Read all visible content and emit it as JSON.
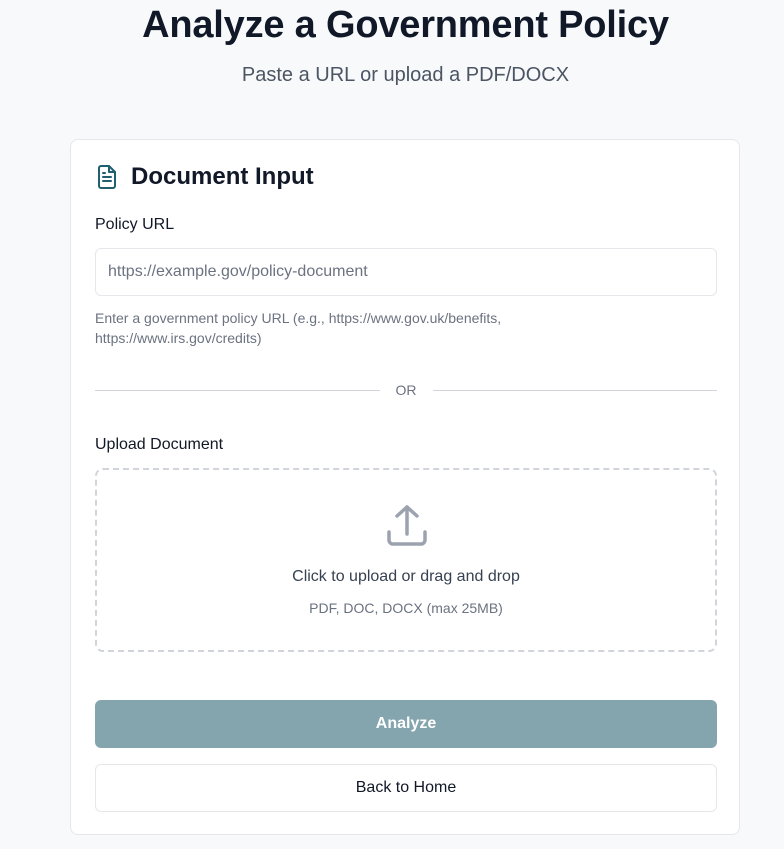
{
  "header": {
    "title": "Analyze a Government Policy",
    "subtitle": "Paste a URL or upload a PDF/DOCX"
  },
  "card": {
    "icon": "document-icon",
    "title": "Document Input"
  },
  "url_field": {
    "label": "Policy URL",
    "value": "",
    "placeholder": "https://example.gov/policy-document",
    "help": "Enter a government policy URL (e.g., https://www.gov.uk/benefits, https://www.irs.gov/credits)"
  },
  "divider": {
    "text": "OR"
  },
  "upload": {
    "label": "Upload Document",
    "icon": "upload-icon",
    "title": "Click to upload or drag and drop",
    "hint": "PDF, DOC, DOCX (max 25MB)"
  },
  "actions": {
    "analyze_label": "Analyze",
    "home_label": "Back to Home"
  },
  "colors": {
    "accent_disabled": "#84a5ad",
    "icon_teal": "#1f5f6e",
    "background": "#f8f9fb"
  }
}
